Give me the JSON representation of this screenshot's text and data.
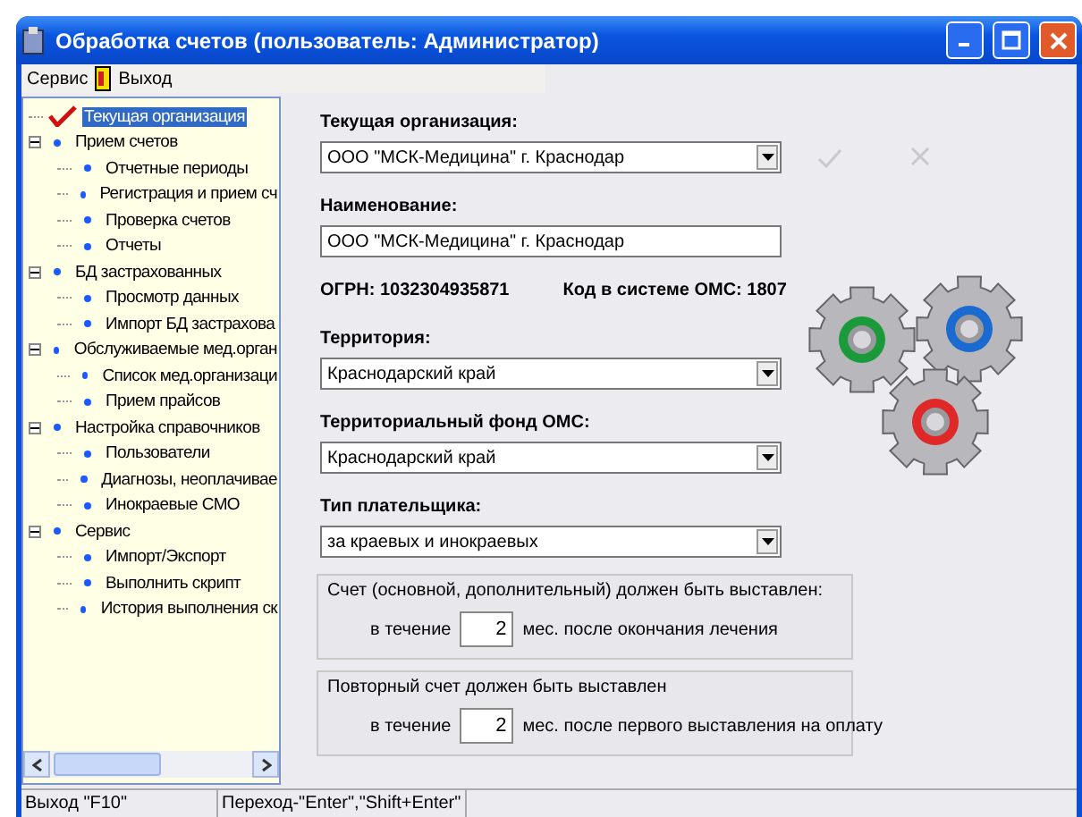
{
  "window": {
    "title": "Обработка счетов (пользователь: Администратор)"
  },
  "menu": [
    {
      "label": "Сервис",
      "kind": "text"
    },
    {
      "label": "Выход",
      "kind": "exit"
    }
  ],
  "tree": [
    {
      "label": "Текущая организация",
      "selected": true,
      "kind": "check"
    },
    {
      "label": "Прием счетов",
      "selected": false,
      "kind": "dot",
      "expanded": true,
      "children": [
        {
          "label": "Отчетные периоды",
          "selected": false
        },
        {
          "label": "Регистрация и прием сч",
          "selected": false
        },
        {
          "label": "Проверка счетов",
          "selected": false
        },
        {
          "label": "Отчеты",
          "selected": false
        }
      ]
    },
    {
      "label": "БД застрахованных",
      "selected": false,
      "kind": "dot",
      "expanded": true,
      "children": [
        {
          "label": "Просмотр данных",
          "selected": false
        },
        {
          "label": "Импорт БД застрахова",
          "selected": false
        }
      ]
    },
    {
      "label": "Обслуживаемые мед.орган",
      "selected": false,
      "kind": "dot",
      "expanded": true,
      "children": [
        {
          "label": "Список мед.организаци",
          "selected": false
        },
        {
          "label": "Прием прайсов",
          "selected": false
        }
      ]
    },
    {
      "label": "Настройка справочников",
      "selected": false,
      "kind": "dot",
      "expanded": true,
      "children": [
        {
          "label": "Пользователи",
          "selected": false
        },
        {
          "label": "Диагнозы, неоплачивае",
          "selected": false
        },
        {
          "label": "Инокраевые СМО",
          "selected": false
        }
      ]
    },
    {
      "label": "Сервис",
      "selected": false,
      "kind": "dot",
      "expanded": true,
      "children": [
        {
          "label": "Импорт/Экспорт",
          "selected": false
        },
        {
          "label": "Выполнить скрипт",
          "selected": false
        },
        {
          "label": "История выполнения ск",
          "selected": false
        }
      ]
    }
  ],
  "form": [
    {
      "kind": "combo",
      "label": "Текущая организация:",
      "value": "ООО \"МСК-Медицина\" г. Краснодар"
    },
    {
      "kind": "text",
      "label": "Наименование:",
      "value": "ООО \"МСК-Медицина\" г. Краснодар"
    },
    {
      "kind": "info",
      "left": "ОГРН: 1032304935871",
      "right": "Код в системе ОМС: 1807"
    },
    {
      "kind": "combo",
      "label": "Территория:",
      "value": "Краснодарский край"
    },
    {
      "kind": "combo",
      "label": "Территориальный фонд ОМС:",
      "value": "Краснодарский край"
    },
    {
      "kind": "combo",
      "label": "Тип плательщика:",
      "value": "за краевых и инокраевых"
    }
  ],
  "groups": [
    {
      "caption": "Счет (основной, дополнительный) должен быть выставлен:",
      "prefix": "в течение",
      "value": "2",
      "suffix": "мес. после окончания лечения"
    },
    {
      "caption": "Повторный счет должен быть выставлен",
      "prefix": "в течение",
      "value": "2",
      "suffix": "мес. после первого выставления на оплату"
    }
  ],
  "status_bar": [
    "Выход \"F10\"",
    "Переход-\"Enter\",\"Shift+Enter\""
  ]
}
